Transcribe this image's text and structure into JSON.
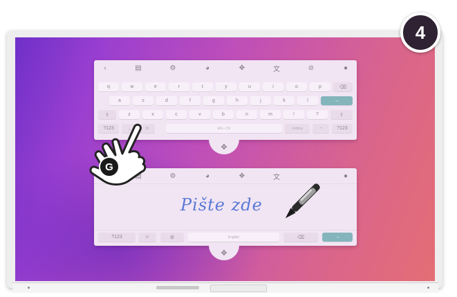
{
  "step_badge": "4",
  "gesture_badge": "G",
  "keyboard": {
    "toolbar_icons": [
      "back-icon",
      "clipboard-icon",
      "settings-icon",
      "palette-icon",
      "move-icon",
      "translate-icon",
      "handwriting-off-icon",
      "microphone-icon"
    ],
    "row1": [
      "q",
      "w",
      "e",
      "r",
      "t",
      "y",
      "u",
      "i",
      "o",
      "p"
    ],
    "row2": [
      "a",
      "s",
      "d",
      "f",
      "g",
      "h",
      "j",
      "k",
      "l"
    ],
    "row3": [
      "z",
      "x",
      "c",
      "v",
      "b",
      "n",
      "m",
      "!",
      "?"
    ],
    "enter_label": "→",
    "backspace_label": "⌫",
    "shift_label": "⇧",
    "symbols_label": "?123",
    "comma_label": ",",
    "emoji_label": "☺",
    "space_label": "EN • CS",
    "period_label": ".",
    "dash_label": "-",
    "numbers_label": "?123",
    "lang_label": "čeština"
  },
  "handwriting": {
    "sample_text": "Pište zde",
    "symbols_label": "?123",
    "emoji_label": "☺",
    "settings_label": "⚙",
    "space_label": "English",
    "backspace_label": "⌫",
    "enter_label": "→"
  },
  "colors": {
    "panel": "#f1e5f3",
    "enter_key": "#84b5bd",
    "handwriting_ink": "#5a79d6",
    "badge": "#2e2233"
  }
}
